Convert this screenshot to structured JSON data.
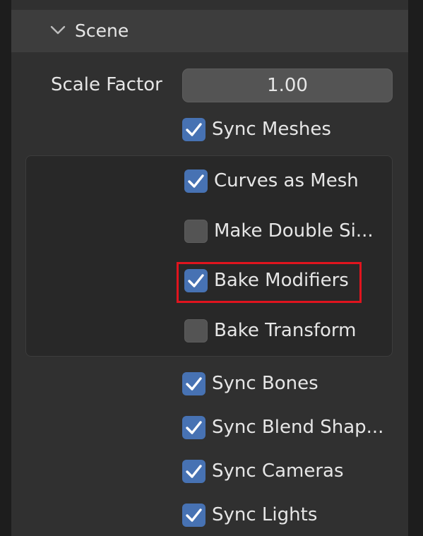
{
  "panel": {
    "title": "Scene",
    "scale_factor": {
      "label": "Scale Factor",
      "value": "1.00"
    },
    "options": [
      {
        "label": "Sync Meshes",
        "checked": true
      },
      {
        "label": "Curves as Mesh",
        "checked": true
      },
      {
        "label": "Make Double Si...",
        "checked": false
      },
      {
        "label": "Bake Modifiers",
        "checked": true
      },
      {
        "label": "Bake Transform",
        "checked": false
      },
      {
        "label": "Sync Bones",
        "checked": true
      },
      {
        "label": "Sync Blend Shap...",
        "checked": true
      },
      {
        "label": "Sync Cameras",
        "checked": true
      },
      {
        "label": "Sync Lights",
        "checked": true
      }
    ]
  },
  "colors": {
    "background": "#303030",
    "header": "#3d3d3d",
    "checkbox_on": "#4772b3",
    "checkbox_off": "#545454",
    "highlight": "#e0141e"
  },
  "icons": {
    "collapse": "chevron-down-icon",
    "check": "checkmark-icon"
  }
}
